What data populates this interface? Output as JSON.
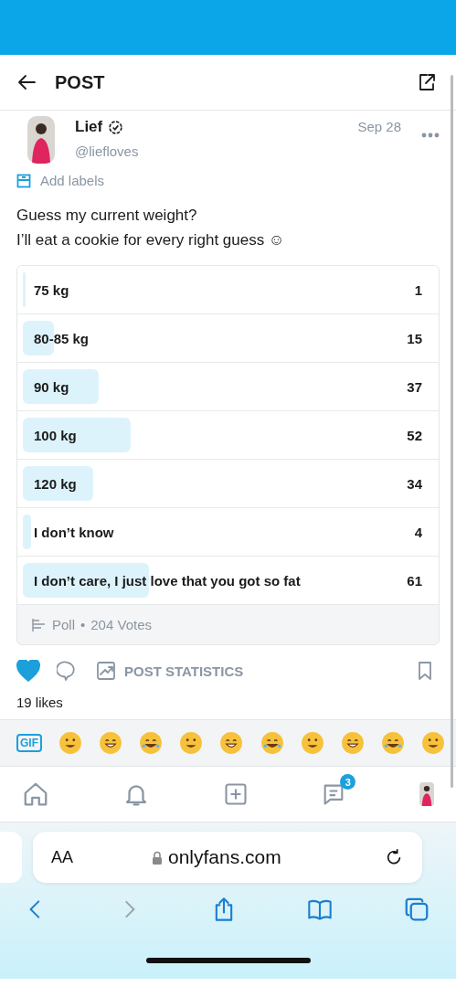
{
  "header": {
    "title": "POST"
  },
  "author": {
    "name": "Lief",
    "verified": true,
    "handle": "@liefloves",
    "date": "Sep 28"
  },
  "labels_link": "Add labels",
  "post_text": [
    "Guess my current weight?",
    "I’ll eat a cookie for every right guess ☺"
  ],
  "poll": {
    "options": [
      {
        "label": "75 kg",
        "votes": "1",
        "level": 0.005
      },
      {
        "label": "80-85 kg",
        "votes": "15",
        "level": 0.074
      },
      {
        "label": "90 kg",
        "votes": "37",
        "level": 0.181
      },
      {
        "label": "100 kg",
        "votes": "52",
        "level": 0.255
      },
      {
        "label": "120 kg",
        "votes": "34",
        "level": 0.167
      },
      {
        "label": "I don’t know",
        "votes": "4",
        "level": 0.02
      },
      {
        "label": "I don’t care, I just love that you got so fat",
        "votes": "61",
        "level": 0.299
      }
    ],
    "kind_label": "Poll",
    "separator": "•",
    "votes_total": "204 Votes"
  },
  "actions": {
    "liked": true,
    "stats_label": "POST STATISTICS"
  },
  "likes": "19 likes",
  "emoji_bar": {
    "gif_label": "GIF"
  },
  "bottom_nav": {
    "messages_badge": "3"
  },
  "browser": {
    "text_size": "AA",
    "url": "onlyfans.com"
  }
}
